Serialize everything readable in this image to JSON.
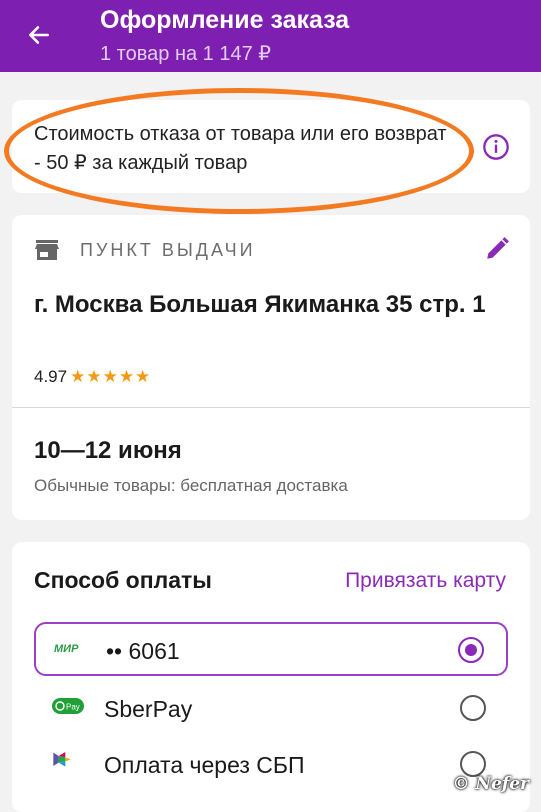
{
  "header": {
    "title": "Оформление заказа",
    "subtitle": "1 товар на 1 147 ₽"
  },
  "notice": {
    "text": "Стоимость отказа от товара или его возврат - 50 ₽ за каждый товар",
    "icon": "info-icon",
    "highlight_color": "#f47a22"
  },
  "pickup": {
    "label": "ПУНКТ ВЫДАЧИ",
    "address": "г. Москва Большая Якиманка  35 стр. 1",
    "rating": "4.97",
    "stars": "★★★★★",
    "rating_value": 5,
    "date": "10—12 июня",
    "delivery_note": "Обычные товары: бесплатная доставка"
  },
  "payment": {
    "title": "Способ оплаты",
    "link_card": "Привязать карту",
    "methods": [
      {
        "label": "•• 6061",
        "logo": "mir-logo",
        "logo_text": "МИР",
        "selected": true
      },
      {
        "label": "SberPay",
        "logo": "sberpay-logo",
        "logo_text": "Pay",
        "selected": false
      },
      {
        "label": "Оплата через СБП",
        "logo": "sbp-logo",
        "selected": false
      }
    ]
  },
  "watermark": "© Nefer",
  "colors": {
    "header_bg": "#7d1fb0",
    "accent": "#8a2bb8",
    "stars": "#f39a12",
    "background": "#f2f2f2"
  }
}
